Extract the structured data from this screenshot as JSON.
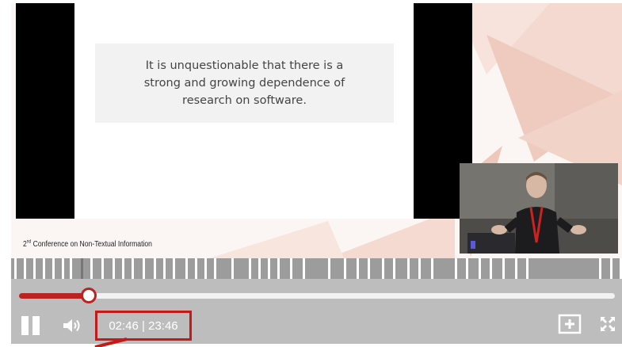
{
  "slide": {
    "quote": "It is unquestionable that there is a strong and growing dependence of research on software.",
    "conference_prefix": "2",
    "conference_sup": "nd",
    "conference_rest": " Conference on Non-Textual Information"
  },
  "player": {
    "progress_fraction": 0.117,
    "current_time": "02:46",
    "duration": "23:46",
    "time_separator": " | ",
    "accent_color": "#bb2222"
  },
  "icons": {
    "play_pause": "pause-icon",
    "volume": "volume-icon",
    "add": "plus-box-icon",
    "fullscreen": "fullscreen-icon"
  }
}
